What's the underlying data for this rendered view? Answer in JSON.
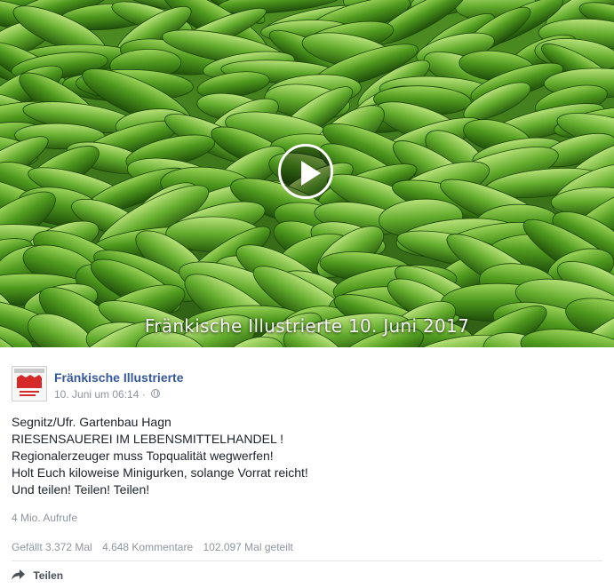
{
  "video": {
    "caption": "Fränkische Illustrierte 10. Juni 2017",
    "play_icon": "play-icon"
  },
  "header": {
    "page_name": "Fränkische Illustrierte",
    "timestamp": "10. Juni um 06:14",
    "dot": "·",
    "privacy_icon": "globe-icon"
  },
  "post": {
    "lines": [
      "Segnitz/Ufr. Gartenbau Hagn",
      "RIESENSAUEREI IM LEBENSMITTELHANDEL !",
      "Regionalerzeuger muss Topqualität wegwerfen!",
      "Holt Euch kiloweise Minigurken, solange Vorrat reicht!",
      "Und teilen! Teilen! Teilen!"
    ]
  },
  "views": "4 Mio. Aufrufe",
  "stats": {
    "likes": "Gefällt 3.372 Mal",
    "comments": "4.648 Kommentare",
    "shares": "102.097 Mal geteilt"
  },
  "actions": {
    "share_label": "Teilen",
    "share_icon": "share-arrow-icon"
  },
  "colors": {
    "link": "#365899",
    "meta": "#90949c",
    "cucumber_dark": "#2f6a12",
    "cucumber_light": "#7fc23a"
  }
}
